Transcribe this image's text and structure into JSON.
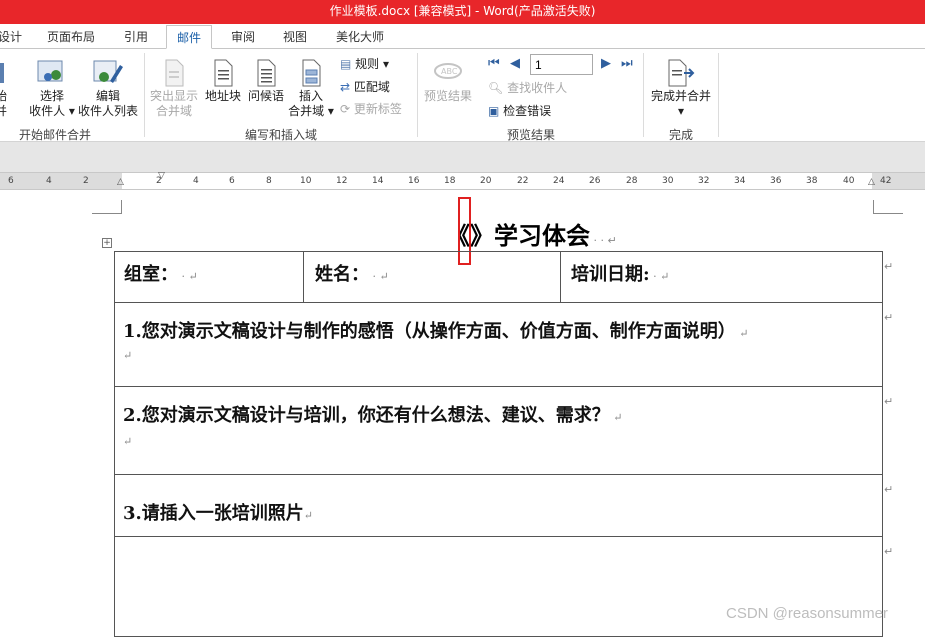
{
  "window": {
    "title": "作业模板.docx [兼容模式] - Word(产品激活失败)"
  },
  "tabs": [
    {
      "label": "设计"
    },
    {
      "label": "页面布局"
    },
    {
      "label": "引用"
    },
    {
      "label": "邮件",
      "active": true
    },
    {
      "label": "审阅"
    },
    {
      "label": "视图"
    },
    {
      "label": "美化大师"
    }
  ],
  "ribbon": {
    "start_group": {
      "btn0_l1": "始",
      "btn0_l2": "并",
      "btn1_l1": "选择",
      "btn1_l2": "收件人",
      "btn2_l1": "编辑",
      "btn2_l2": "收件人列表",
      "label": "开始邮件合并"
    },
    "write_group": {
      "highlight_l1": "突出显示",
      "highlight_l2": "合并域",
      "address": "地址块",
      "greeting": "问候语",
      "insert_l1": "插入",
      "insert_l2": "合并域",
      "rules": "规则",
      "match": "匹配域",
      "update": "更新标签",
      "label": "编写和插入域"
    },
    "preview_group": {
      "preview": "预览结果",
      "record_value": "1",
      "find": "查找收件人",
      "check": "检查错误",
      "label": "预览结果"
    },
    "finish_group": {
      "finish": "完成并合并",
      "label": "完成"
    }
  },
  "ruler": {
    "ticks": [
      "6",
      "4",
      "2",
      "2",
      "4",
      "6",
      "8",
      "10",
      "12",
      "14",
      "16",
      "18",
      "20",
      "22",
      "24",
      "26",
      "28",
      "30",
      "32",
      "34",
      "36",
      "38",
      "40",
      "42"
    ]
  },
  "document": {
    "title": "《》学习体会",
    "row1": {
      "group": "组室：",
      "name": "姓名：",
      "date": "培训日期:"
    },
    "q1": "1.您对演示文稿设计与制作的感悟（从操作方面、价值方面、制作方面说明）",
    "q2": "2.您对演示文稿设计与培训，你还有什么想法、建议、需求？",
    "q3": "3.请插入一张培训照片"
  },
  "watermark": "CSDN @reasonsummer",
  "colors": {
    "titlebar": "#e8262a",
    "accent": "#1a5fa8"
  }
}
